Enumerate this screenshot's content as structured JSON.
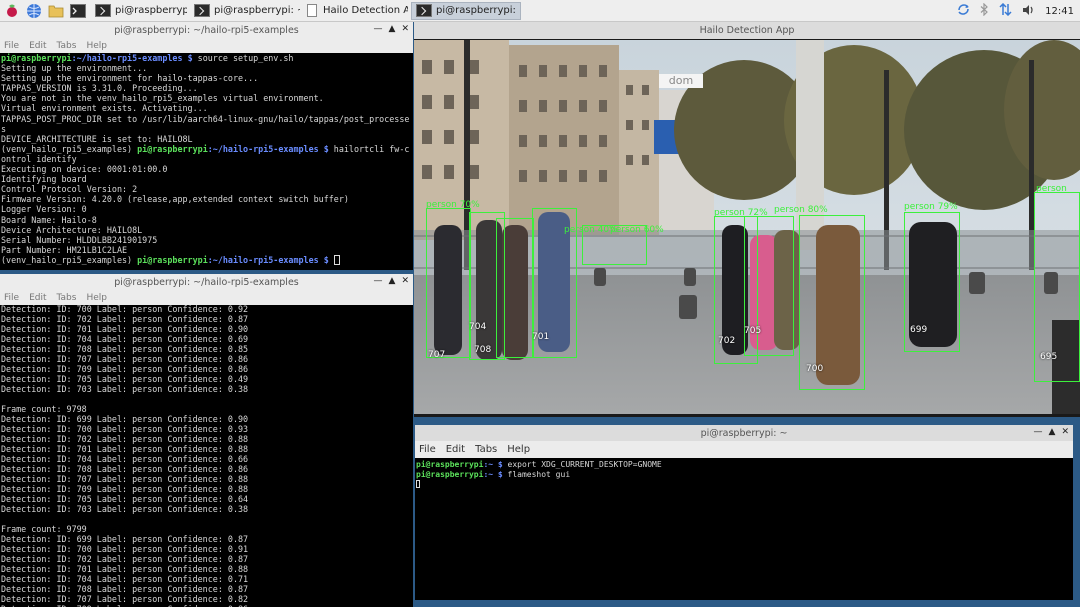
{
  "taskbar": {
    "tasks": [
      {
        "label": "pi@raspberrypi: ~/h..."
      },
      {
        "label": "pi@raspberrypi: ~/h..."
      },
      {
        "label": "Hailo Detection App"
      },
      {
        "label": "pi@raspberrypi: ~"
      }
    ],
    "clock": "12:41"
  },
  "term1": {
    "title": "pi@raspberrypi: ~/hailo-rpi5-examples",
    "menu": [
      "File",
      "Edit",
      "Tabs",
      "Help"
    ],
    "prompt_user": "pi@raspberrypi",
    "prompt_path": ":~/hailo-rpi5-examples $",
    "prompt_path2": ":~/hailo-rpi5-examples $",
    "prompt_path3": ":~/hailo-rpi5-examples $",
    "venv": "(venv_hailo_rpi5_examples) ",
    "cmd1": " source setup_env.sh",
    "cmd2": " hailortcli fw-control identify",
    "lines1": [
      "Setting up the environment...",
      "Setting up the environment for hailo-tappas-core...",
      "TAPPAS_VERSION is 3.31.0. Proceeding...",
      "You are not in the venv_hailo_rpi5_examples virtual environment.",
      "Virtual environment exists. Activating...",
      "TAPPAS_POST_PROC_DIR set to /usr/lib/aarch64-linux-gnu/hailo/tappas/post_processes",
      "DEVICE_ARCHITECTURE is set to: HAILO8L"
    ],
    "lines2": [
      "Executing on device: 0001:01:00.0",
      "Identifying board",
      "Control Protocol Version: 2",
      "Firmware Version: 4.20.0 (release,app,extended context switch buffer)",
      "Logger Version: 0",
      "Board Name: Hailo-8",
      "Device Architecture: HAILO8L",
      "Serial Number: HLDDLBB241901975",
      "Part Number: HM21LB1C2LAE"
    ]
  },
  "term2": {
    "title": "pi@raspberrypi: ~/hailo-rpi5-examples",
    "menu": [
      "File",
      "Edit",
      "Tabs",
      "Help"
    ],
    "lines": [
      "Detection: ID: 700 Label: person Confidence: 0.92",
      "Detection: ID: 702 Label: person Confidence: 0.87",
      "Detection: ID: 701 Label: person Confidence: 0.90",
      "Detection: ID: 704 Label: person Confidence: 0.69",
      "Detection: ID: 708 Label: person Confidence: 0.85",
      "Detection: ID: 707 Label: person Confidence: 0.86",
      "Detection: ID: 709 Label: person Confidence: 0.86",
      "Detection: ID: 705 Label: person Confidence: 0.49",
      "Detection: ID: 703 Label: person Confidence: 0.38",
      "",
      "Frame count: 9798",
      "Detection: ID: 699 Label: person Confidence: 0.90",
      "Detection: ID: 700 Label: person Confidence: 0.93",
      "Detection: ID: 702 Label: person Confidence: 0.88",
      "Detection: ID: 701 Label: person Confidence: 0.88",
      "Detection: ID: 704 Label: person Confidence: 0.66",
      "Detection: ID: 708 Label: person Confidence: 0.86",
      "Detection: ID: 707 Label: person Confidence: 0.88",
      "Detection: ID: 709 Label: person Confidence: 0.88",
      "Detection: ID: 705 Label: person Confidence: 0.64",
      "Detection: ID: 703 Label: person Confidence: 0.38",
      "",
      "Frame count: 9799",
      "Detection: ID: 699 Label: person Confidence: 0.87",
      "Detection: ID: 700 Label: person Confidence: 0.91",
      "Detection: ID: 702 Label: person Confidence: 0.87",
      "Detection: ID: 701 Label: person Confidence: 0.88",
      "Detection: ID: 704 Label: person Confidence: 0.71",
      "Detection: ID: 708 Label: person Confidence: 0.87",
      "Detection: ID: 707 Label: person Confidence: 0.82",
      "Detection: ID: 709 Label: person Confidence: 0.86",
      "Detection: ID: 705 Label: person Confidence: 0.43",
      "Detection: ID: 703 Label: person Confidence: 0.38"
    ]
  },
  "app": {
    "title": "Hailo Detection App",
    "sign": "dom",
    "labels": [
      "person 72%",
      "person 80%",
      "person 79%",
      "person 40%",
      "person 70%",
      "person 60%",
      "person"
    ],
    "ids": [
      "707",
      "708",
      "704",
      "701",
      "705",
      "702",
      "700",
      "699",
      "695"
    ]
  },
  "term3": {
    "title": "pi@raspberrypi: ~",
    "menu": [
      "File",
      "Edit",
      "Tabs",
      "Help"
    ],
    "user": "pi@raspberrypi",
    "path": ":~ $",
    "cmd1": " export XDG_CURRENT_DESKTOP=GNOME",
    "cmd2": " flameshot gui"
  }
}
